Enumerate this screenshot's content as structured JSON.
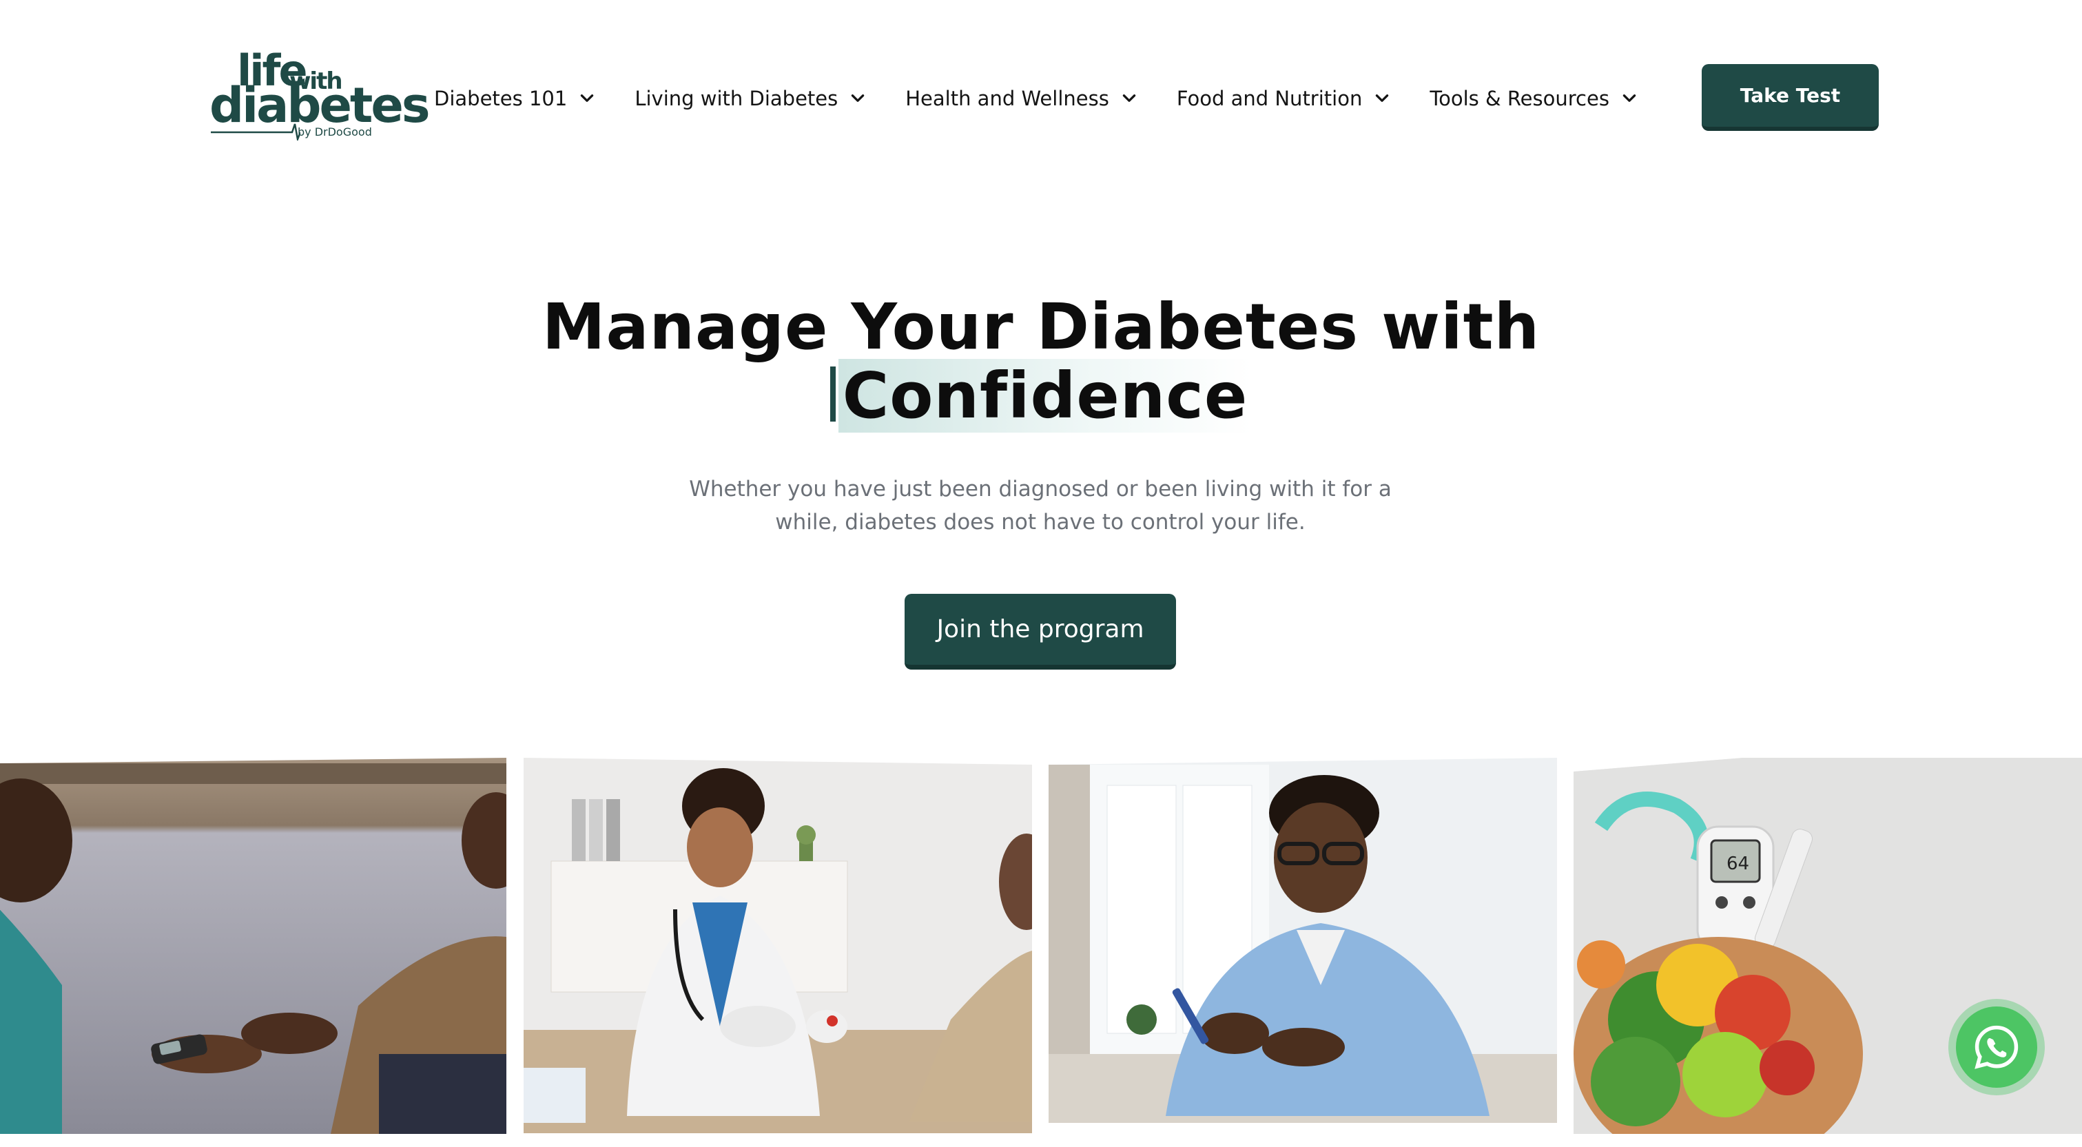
{
  "brand": {
    "logo_line1": "life",
    "logo_with": "with",
    "logo_line2": "diabetes",
    "logo_by": "by DrDoGood",
    "primary_color": "#1f4a46",
    "accent_whatsapp": "#4dc564"
  },
  "nav": {
    "items": [
      {
        "label": "Diabetes 101",
        "icon": "chevron-down-icon"
      },
      {
        "label": "Living with Diabetes",
        "icon": "chevron-down-icon"
      },
      {
        "label": "Health and Wellness",
        "icon": "chevron-down-icon"
      },
      {
        "label": "Food and Nutrition",
        "icon": "chevron-down-icon"
      },
      {
        "label": "Tools & Resources",
        "icon": "chevron-down-icon"
      }
    ],
    "cta_label": "Take Test"
  },
  "hero": {
    "title_line1": "Manage Your Diabetes with",
    "title_line2": "Confidence",
    "subtitle": "Whether you have just been diagnosed or been living with it for a while, diabetes does not have to control your life.",
    "cta_label": "Join the program"
  },
  "gallery": {
    "images": [
      {
        "name": "nurse-checking-glucose-photo"
      },
      {
        "name": "doctor-with-patient-photo"
      },
      {
        "name": "man-testing-blood-sugar-photo"
      },
      {
        "name": "glucometer-and-fruits-photo"
      }
    ]
  },
  "floating": {
    "whatsapp_icon": "whatsapp-icon"
  }
}
